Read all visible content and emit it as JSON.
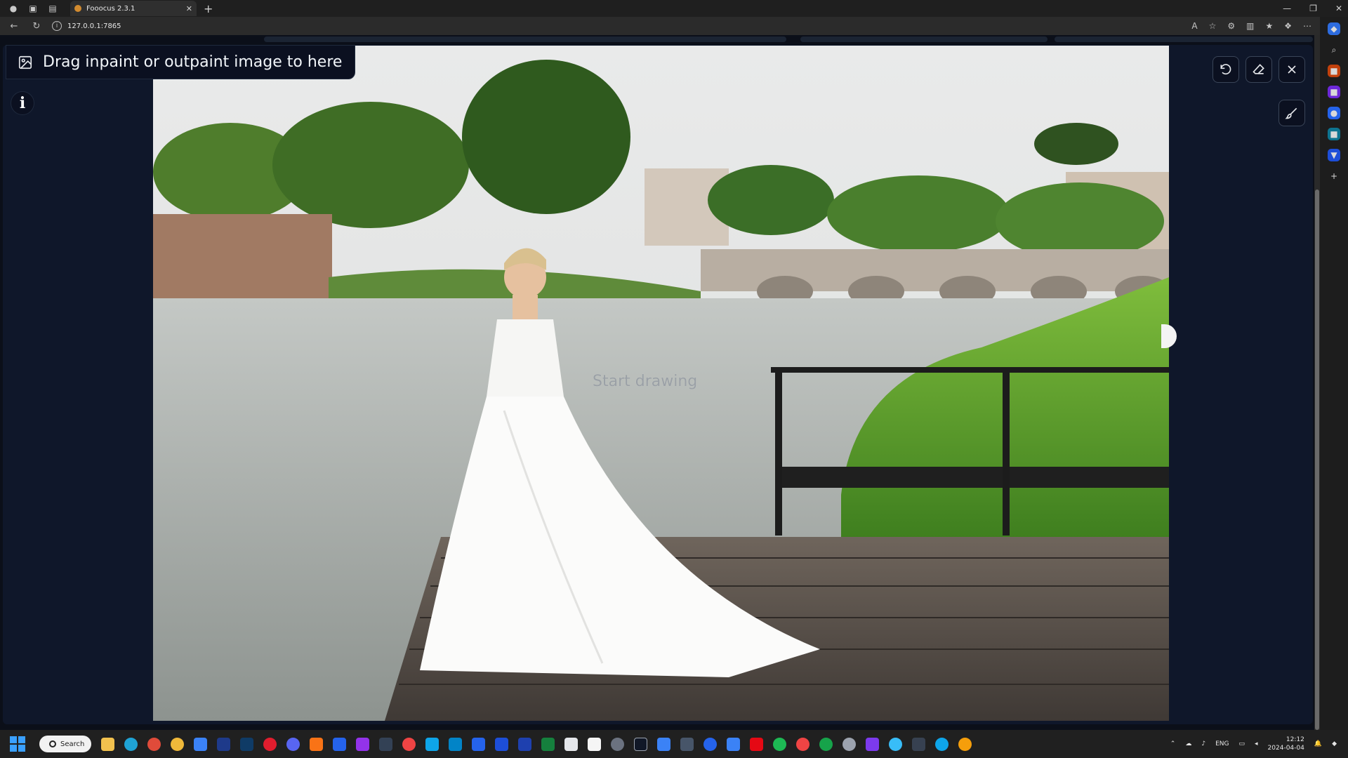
{
  "browser": {
    "tab_title": "Fooocus 2.3.1",
    "url": "127.0.0.1:7865"
  },
  "editor": {
    "drop_label": "Drag inpaint or outpaint image to here",
    "info_button": "i",
    "placeholder_hint": "Start drawing"
  },
  "icons": {
    "image": "image-icon",
    "undo": "undo-icon",
    "eraser": "eraser-icon",
    "close": "close-icon",
    "brush": "brush-icon"
  },
  "taskbar": {
    "search_label": "Search",
    "language": "ENG",
    "time": "12:12",
    "date": "2024-04-04"
  },
  "colors": {
    "app_bg": "#0b0f19",
    "editor_bg": "#0f172a",
    "accent": "#3aa0ff"
  }
}
